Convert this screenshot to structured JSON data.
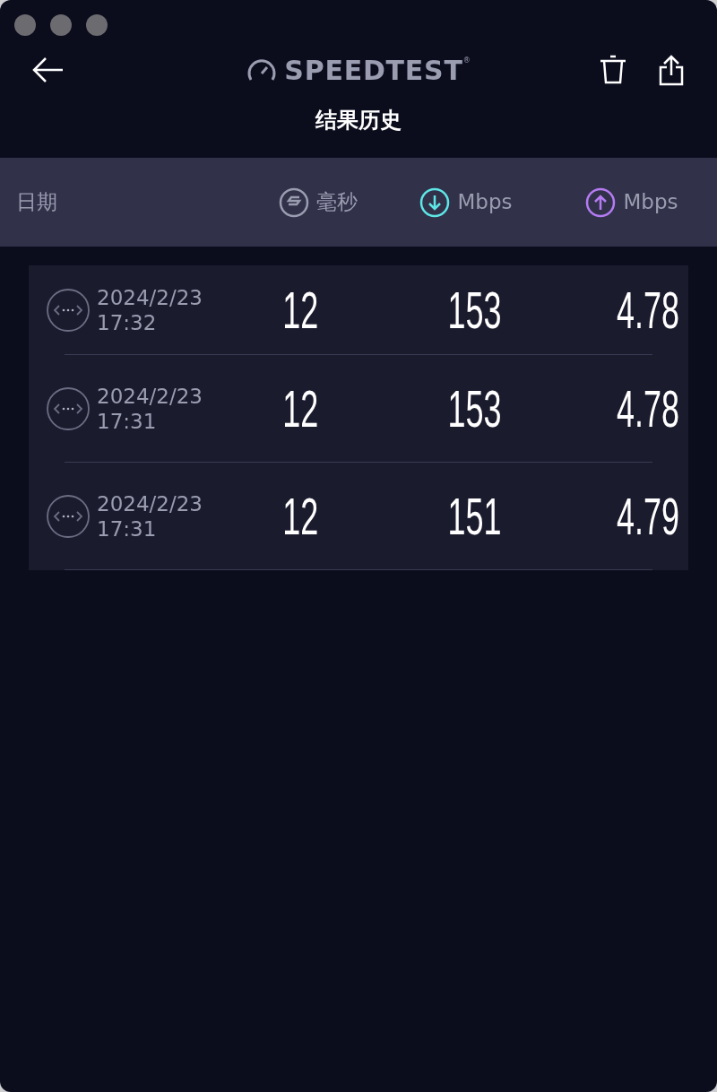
{
  "header": {
    "brand": "SPEEDTEST",
    "brand_mark": "®",
    "title": "结果历史"
  },
  "columns": [
    {
      "kind": "date",
      "label": "日期"
    },
    {
      "kind": "ping",
      "label": "毫秒"
    },
    {
      "kind": "download",
      "label": "Mbps"
    },
    {
      "kind": "upload",
      "label": "Mbps"
    }
  ],
  "rows": [
    {
      "date": "2024/2/23",
      "time": "17:32",
      "ping": "12",
      "download": "153",
      "upload": "4.78"
    },
    {
      "date": "2024/2/23",
      "time": "17:31",
      "ping": "12",
      "download": "153",
      "upload": "4.78"
    },
    {
      "date": "2024/2/23",
      "time": "17:31",
      "ping": "12",
      "download": "151",
      "upload": "4.79"
    }
  ]
}
